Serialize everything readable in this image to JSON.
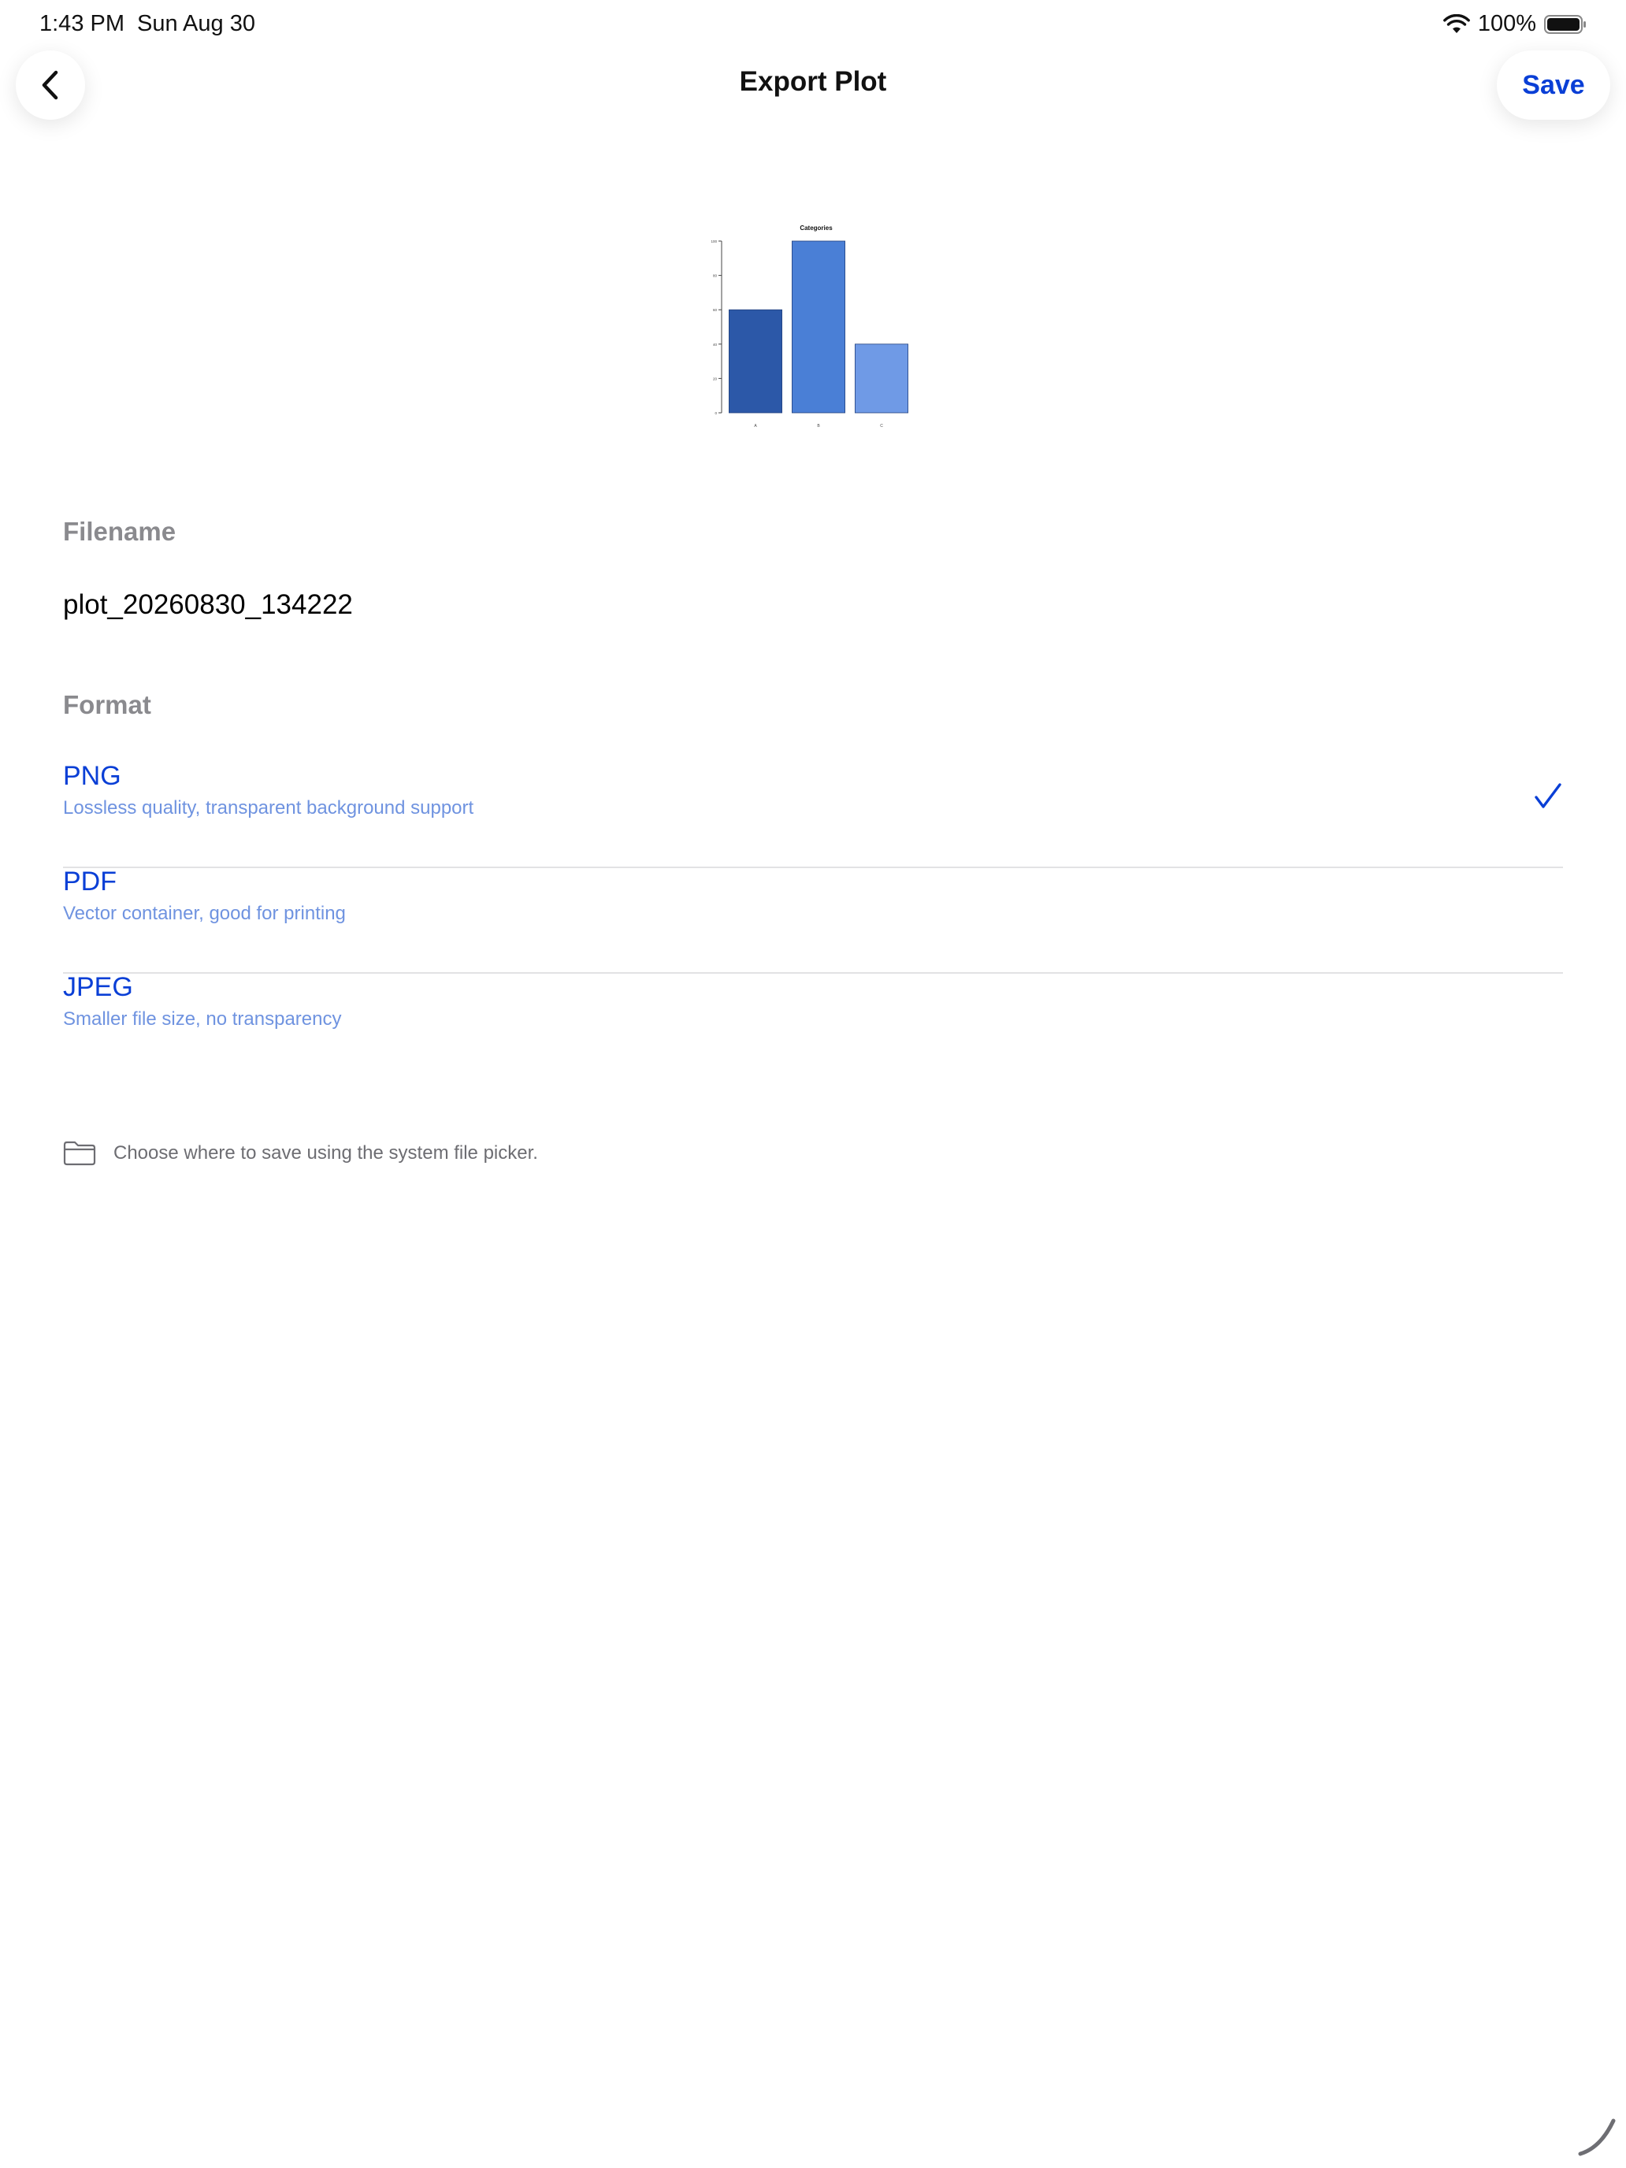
{
  "status_bar": {
    "time": "1:43 PM",
    "date": "Sun Aug 30",
    "battery": "100%"
  },
  "header": {
    "title": "Export Plot",
    "save_label": "Save",
    "back_icon": "chevron-left-icon"
  },
  "preview": {
    "chart_data": {
      "type": "bar",
      "title": "Categories",
      "categories": [
        "A",
        "B",
        "C"
      ],
      "values": [
        60,
        100,
        40
      ],
      "ylim": [
        0,
        100
      ],
      "y_ticks": [
        "0",
        "20",
        "40",
        "60",
        "80",
        "100"
      ],
      "colors": [
        "#2c58a8",
        "#4a7fd6",
        "#6f9ae6"
      ],
      "grid": false
    }
  },
  "filename": {
    "label": "Filename",
    "value": "plot_20260830_134222"
  },
  "format": {
    "label": "Format",
    "options": [
      {
        "name": "PNG",
        "description": "Lossless quality, transparent background support",
        "selected": true
      },
      {
        "name": "PDF",
        "description": "Vector container, good for printing",
        "selected": false
      },
      {
        "name": "JPEG",
        "description": "Smaller file size, no transparency",
        "selected": false
      }
    ]
  },
  "hint": {
    "text": "Choose where to save using the system file picker.",
    "icon": "folder-icon"
  },
  "colors": {
    "accent": "#0a3fd6",
    "accent_light": "#6f93e0",
    "section_label": "#8a8a8e"
  }
}
